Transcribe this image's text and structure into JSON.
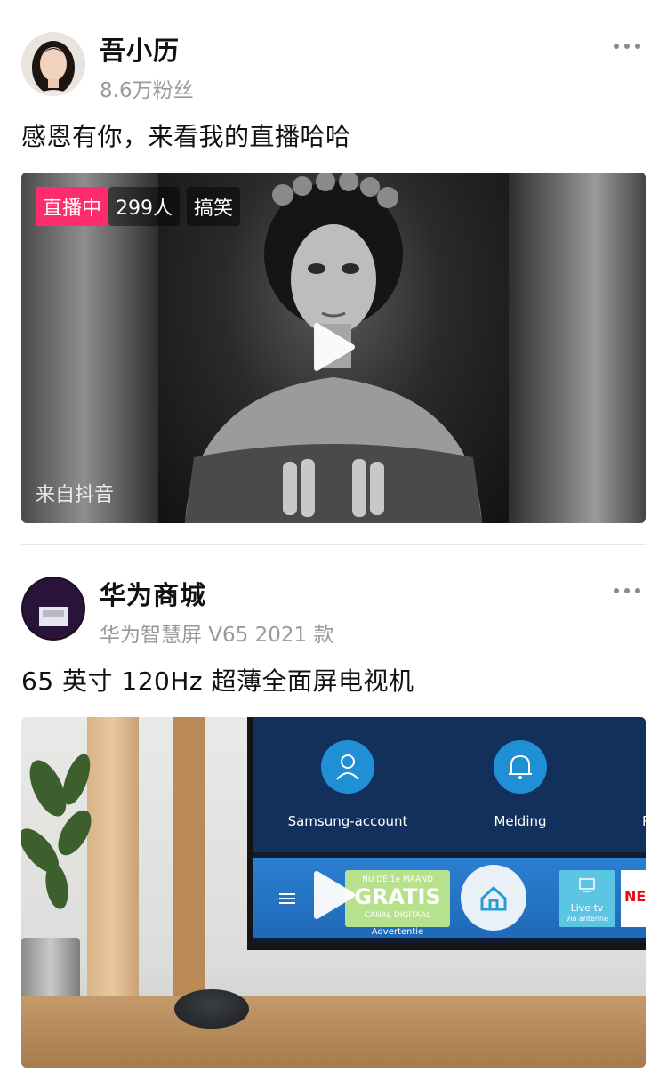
{
  "posts": [
    {
      "author": "吾小历",
      "sub": "8.6万粉丝",
      "text": "感恩有你，来看我的直播哈哈",
      "media": {
        "type": "live",
        "live_tag": "直播中",
        "viewers": "299人",
        "category": "搞笑",
        "source": "来自抖音"
      }
    },
    {
      "author": "华为商城",
      "sub": "华为智慧屏 V65 2021 款",
      "text": "65 英寸 120Hz 超薄全面屏电视机",
      "media": {
        "type": "video",
        "tv_tiles": [
          "Samsung-account",
          "Melding"
        ],
        "tv_tile_partial": "P",
        "promo_line1": "NU DE 1e MAAND",
        "promo_line2": "GRATIS",
        "promo_line3": "CANAL DIGITAAL",
        "promo_caption": "Advertentie",
        "livetv_title": "Live tv",
        "livetv_sub": "Via antenne",
        "netflix": "NET"
      }
    }
  ],
  "colors": {
    "live_badge": "#fe2c6e",
    "secondary_text": "#9a9a9a"
  }
}
